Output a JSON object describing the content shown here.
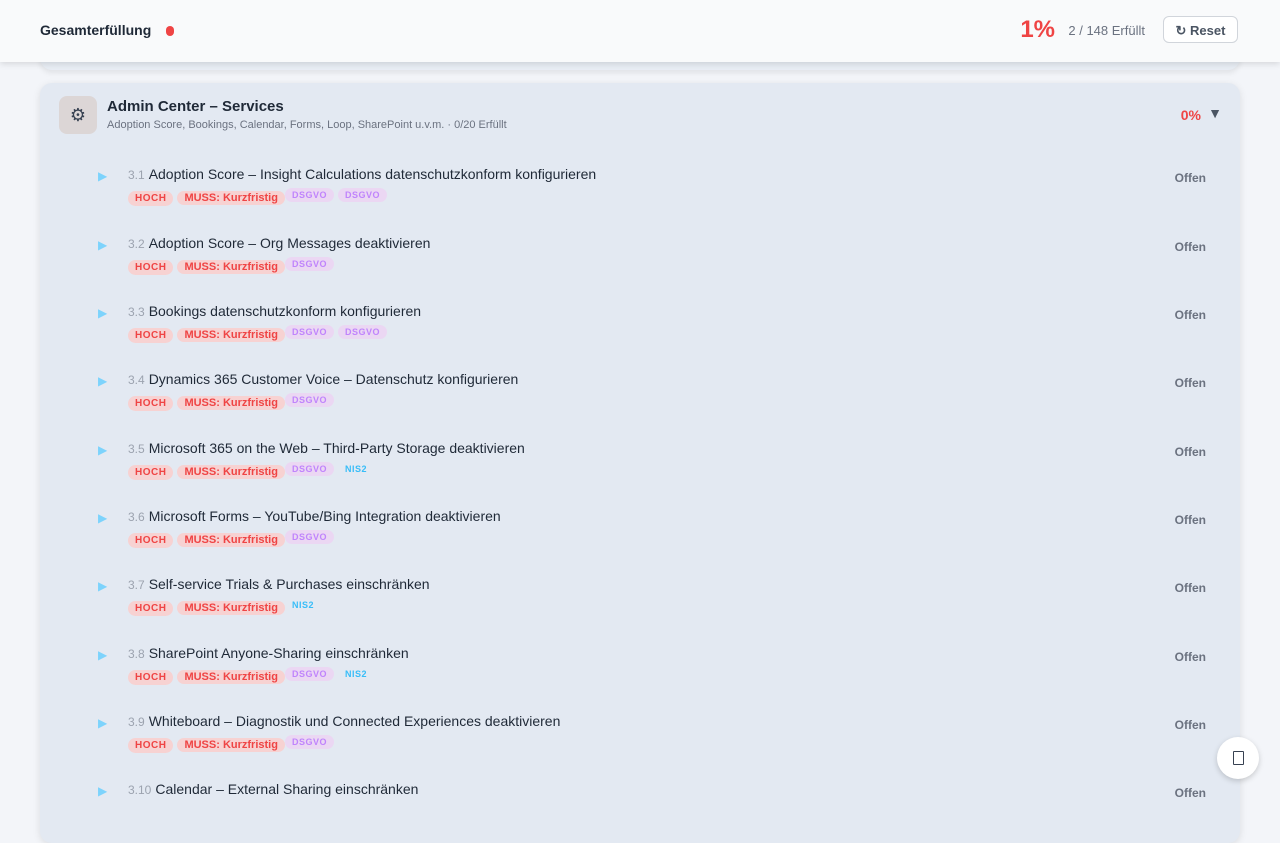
{
  "header": {
    "title": "Gesamterfüllung",
    "percent": "1%",
    "count": "2 / 148 Erfüllt",
    "reset_label": "↻ Reset",
    "progress_fraction": 0.01,
    "accent_color": "#ef4444"
  },
  "section": {
    "icon": "gear-icon",
    "icon_glyph": "⚙",
    "title": "Admin Center – Services",
    "subtitle": "Adoption Score, Bookings, Calendar, Forms, Loop, SharePoint u.v.m. · 0/20 Erfüllt",
    "percent": "0%",
    "chevron": "▼"
  },
  "items": [
    {
      "num": "3.1",
      "title": "Adoption Score – Insight Calculations datenschutzkonform konfigurieren",
      "status": "Offen",
      "priority": "HOCH",
      "requirement": "MUSS: Kurzfristig",
      "tags": [
        "DSGVO",
        "DSGVO"
      ]
    },
    {
      "num": "3.2",
      "title": "Adoption Score – Org Messages deaktivieren",
      "status": "Offen",
      "priority": "HOCH",
      "requirement": "MUSS: Kurzfristig",
      "tags": [
        "DSGVO"
      ]
    },
    {
      "num": "3.3",
      "title": "Bookings datenschutzkonform konfigurieren",
      "status": "Offen",
      "priority": "HOCH",
      "requirement": "MUSS: Kurzfristig",
      "tags": [
        "DSGVO",
        "DSGVO"
      ]
    },
    {
      "num": "3.4",
      "title": "Dynamics 365 Customer Voice – Datenschutz konfigurieren",
      "status": "Offen",
      "priority": "HOCH",
      "requirement": "MUSS: Kurzfristig",
      "tags": [
        "DSGVO"
      ]
    },
    {
      "num": "3.5",
      "title": "Microsoft 365 on the Web – Third-Party Storage deaktivieren",
      "status": "Offen",
      "priority": "HOCH",
      "requirement": "MUSS: Kurzfristig",
      "tags": [
        "DSGVO",
        "NIS2"
      ]
    },
    {
      "num": "3.6",
      "title": "Microsoft Forms – YouTube/Bing Integration deaktivieren",
      "status": "Offen",
      "priority": "HOCH",
      "requirement": "MUSS: Kurzfristig",
      "tags": [
        "DSGVO"
      ]
    },
    {
      "num": "3.7",
      "title": "Self-service Trials & Purchases einschränken",
      "status": "Offen",
      "priority": "HOCH",
      "requirement": "MUSS: Kurzfristig",
      "tags": [
        "NIS2"
      ]
    },
    {
      "num": "3.8",
      "title": "SharePoint Anyone-Sharing einschränken",
      "status": "Offen",
      "priority": "HOCH",
      "requirement": "MUSS: Kurzfristig",
      "tags": [
        "DSGVO",
        "NIS2"
      ]
    },
    {
      "num": "3.9",
      "title": "Whiteboard – Diagnostik und Connected Experiences deaktivieren",
      "status": "Offen",
      "priority": "HOCH",
      "requirement": "MUSS: Kurzfristig",
      "tags": [
        "DSGVO"
      ]
    },
    {
      "num": "3.10",
      "title": "Calendar – External Sharing einschränken",
      "status": "Offen",
      "priority": "",
      "requirement": "",
      "tags": []
    }
  ],
  "expand_glyph": "▶",
  "fab": {
    "icon": "square-icon"
  }
}
